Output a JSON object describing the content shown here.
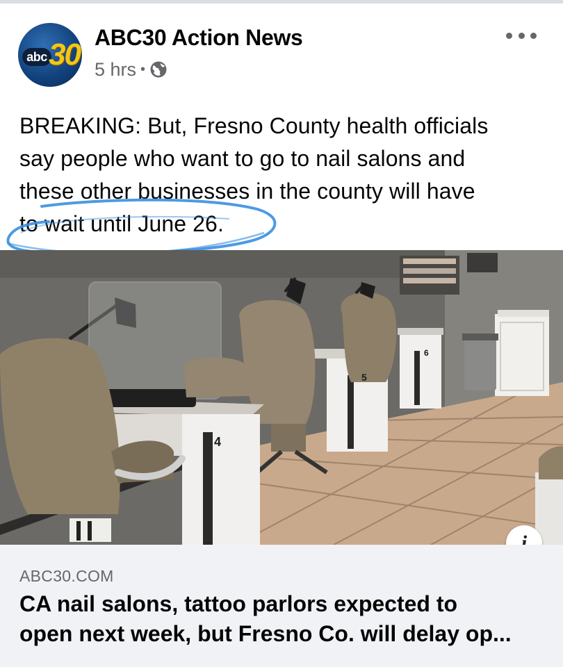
{
  "post": {
    "page_name": "ABC30 Action News",
    "avatar": {
      "wordmark": "abc",
      "number": "30"
    },
    "timestamp": "5 hrs",
    "separator": "•",
    "privacy_icon": "globe-icon",
    "more_icon": "more-horizontal-icon",
    "text_lines": [
      "BREAKING: But, Fresno County health officials",
      "say people who want to go to nail salons and",
      "these other businesses in the county will have",
      "to wait until June 26."
    ],
    "annotation_color": "#3b8fe0"
  },
  "link": {
    "info_icon": "i",
    "domain": "ABC30.COM",
    "title_lines": [
      "CA nail salons, tattoo parlors expected to",
      "open next week, but Fresno Co. will delay op..."
    ],
    "station_numbers": [
      "4",
      "5",
      "6"
    ]
  },
  "colors": {
    "text": "#050505",
    "secondary_text": "#65676b",
    "preview_background": "#f0f2f5"
  }
}
